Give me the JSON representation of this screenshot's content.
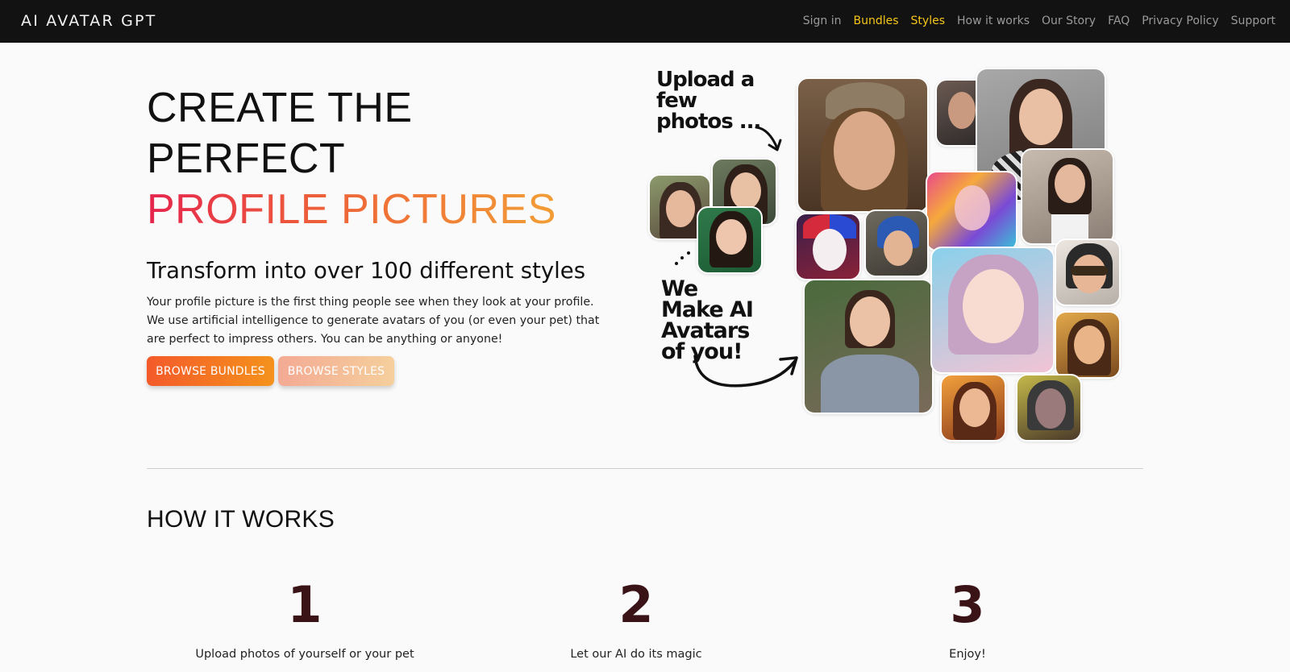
{
  "brand": "AI AVATAR GPT",
  "nav": {
    "items": [
      {
        "label": "Sign in",
        "highlight": false
      },
      {
        "label": "Bundles",
        "highlight": true
      },
      {
        "label": "Styles",
        "highlight": true
      },
      {
        "label": "How it works",
        "highlight": false
      },
      {
        "label": "Our Story",
        "highlight": false
      },
      {
        "label": "FAQ",
        "highlight": false
      },
      {
        "label": "Privacy Policy",
        "highlight": false
      },
      {
        "label": "Support",
        "highlight": false
      }
    ],
    "highlight_color": "#f5c518"
  },
  "hero": {
    "line1": "CREATE THE",
    "line2": "PERFECT",
    "line3a": "PROFILE",
    "line3b": "PICTURES",
    "subtitle": "Transform into over 100 different styles",
    "description": "Your profile picture is the first thing people see when they look at your profile. We use artificial intelligence to generate avatars of you (or even your pet) that are perfect to impress others. You can be anything or anyone!",
    "primary_button": "BROWSE BUNDLES",
    "secondary_button": "BROWSE STYLES"
  },
  "collage": {
    "upload_text": [
      "Upload a",
      "few",
      "photos ..."
    ],
    "make_text": [
      "We",
      "Make AI",
      "Avatars",
      "of you!"
    ]
  },
  "how_it_works": {
    "title": "HOW IT WORKS",
    "steps": [
      {
        "number": "1",
        "text": "Upload photos of yourself or your pet"
      },
      {
        "number": "2",
        "text": "Let our AI do its magic"
      },
      {
        "number": "3",
        "text": "Enjoy!"
      }
    ]
  },
  "colors": {
    "nav_bg": "#121212",
    "accent_orange": "#f45a2a",
    "accent_gradient_red": "#e5254d",
    "step_number": "#3a1317"
  }
}
